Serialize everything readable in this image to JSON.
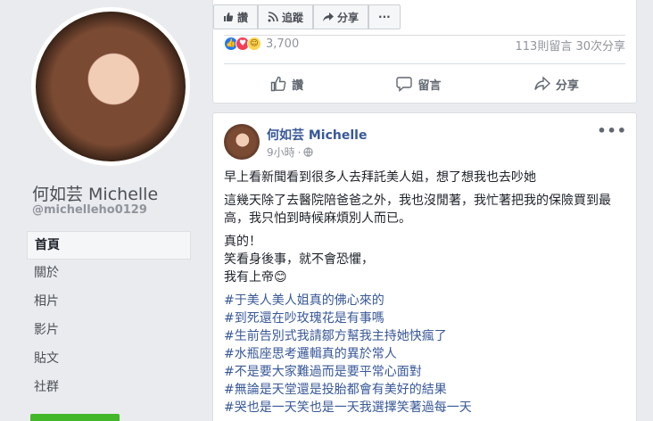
{
  "profile": {
    "name": "何如芸 Michelle",
    "handle": "@michelleho0129"
  },
  "nav": [
    "首頁",
    "關於",
    "相片",
    "影片",
    "貼文",
    "社群"
  ],
  "top_post": {
    "buttons": {
      "like": "讚",
      "follow": "追蹤",
      "share": "分享",
      "more": "···"
    },
    "reaction_count": "3,700",
    "stats": "113則留言  30次分享",
    "actions": {
      "like": "讚",
      "comment": "留言",
      "share": "分享"
    }
  },
  "post": {
    "author": "何如芸 Michelle",
    "time": "9小時",
    "paragraphs": [
      "早上看新聞看到很多人去拜託美人姐，想了想我也去吵她",
      "這幾天除了去醫院陪爸爸之外，我也沒閒著，我忙著把我的保險買到最高，我只怕到時候麻煩別人而已。",
      "真的！\n笑看身後事，就不會恐懼，\n我有上帝😊"
    ],
    "hashtags": [
      "#于美人美人姐真的佛心來的",
      "#到死還在吵玫瑰花是有事嗎",
      "#生前告別式我請鄒方幫我主持她快瘋了",
      "#水瓶座思考邏輯真的異於常人",
      "#不是要大家難過而是要平常心面對",
      "#無論是天堂還是投胎都會有美好的結果",
      "#哭也是一天笑也是一天我選擇笑著過每一天"
    ]
  },
  "colors": {
    "link": "#385898",
    "background": "#e9ebee",
    "like_blue": "#2078f4",
    "love_red": "#f33e58"
  }
}
